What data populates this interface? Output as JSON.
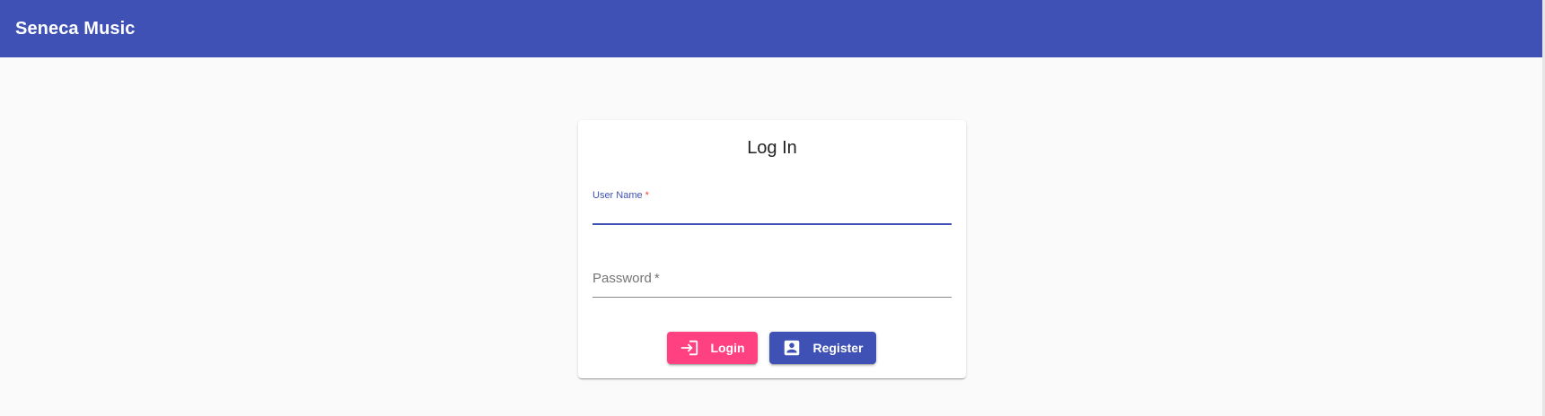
{
  "header": {
    "title": "Seneca Music"
  },
  "login_card": {
    "title": "Log In",
    "fields": {
      "username": {
        "label": "User Name",
        "required_marker": "*",
        "value": ""
      },
      "password": {
        "label": "Password",
        "required_marker": "*",
        "value": ""
      }
    },
    "buttons": {
      "login": {
        "label": "Login",
        "icon": "login-icon"
      },
      "register": {
        "label": "Register",
        "icon": "account-box-icon"
      }
    }
  },
  "colors": {
    "primary": "#3f51b5",
    "accent": "#ff4081",
    "required": "#f44336"
  }
}
